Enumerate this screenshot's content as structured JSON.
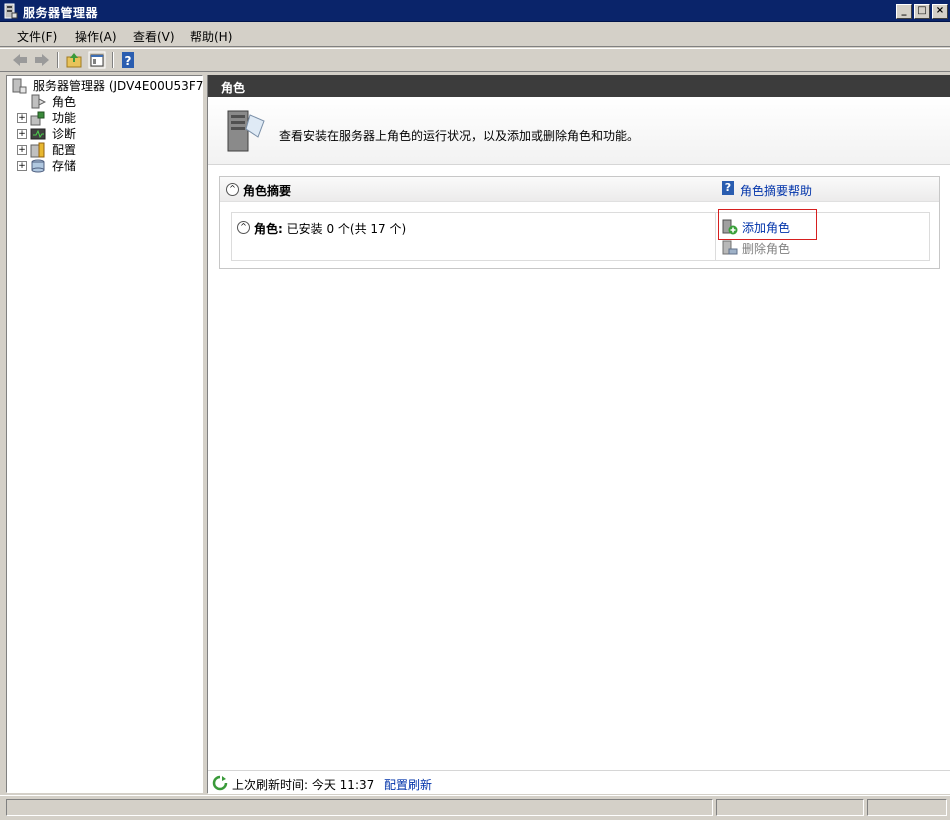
{
  "window": {
    "title": "服务器管理器"
  },
  "menubar": {
    "items": [
      "文件(F)",
      "操作(A)",
      "查看(V)",
      "帮助(H)"
    ]
  },
  "tree": {
    "root": "服务器管理器 (JDV4E00U53F7)",
    "items": [
      {
        "label": "角色",
        "expandable": false,
        "icon": "roles-icon"
      },
      {
        "label": "功能",
        "expandable": true,
        "icon": "features-icon"
      },
      {
        "label": "诊断",
        "expandable": true,
        "icon": "diagnostics-icon"
      },
      {
        "label": "配置",
        "expandable": true,
        "icon": "configuration-icon"
      },
      {
        "label": "存储",
        "expandable": true,
        "icon": "storage-icon"
      }
    ]
  },
  "main": {
    "header": "角色",
    "description": "查看安装在服务器上角色的运行状况，以及添加或删除角色和功能。",
    "summary": {
      "title": "角色摘要",
      "help_link": "角色摘要帮助",
      "roles_label": "角色:",
      "roles_status": "已安装 0 个(共 17 个)",
      "actions": {
        "add": "添加角色",
        "remove": "删除角色"
      }
    },
    "status": {
      "refresh_text": "上次刷新时间: 今天 11:37",
      "configure_link": "配置刷新"
    }
  },
  "colors": {
    "title_bar": "#0a246a",
    "header": "#3c3c3c",
    "link": "#0033aa",
    "highlight": "#d61f1f"
  }
}
